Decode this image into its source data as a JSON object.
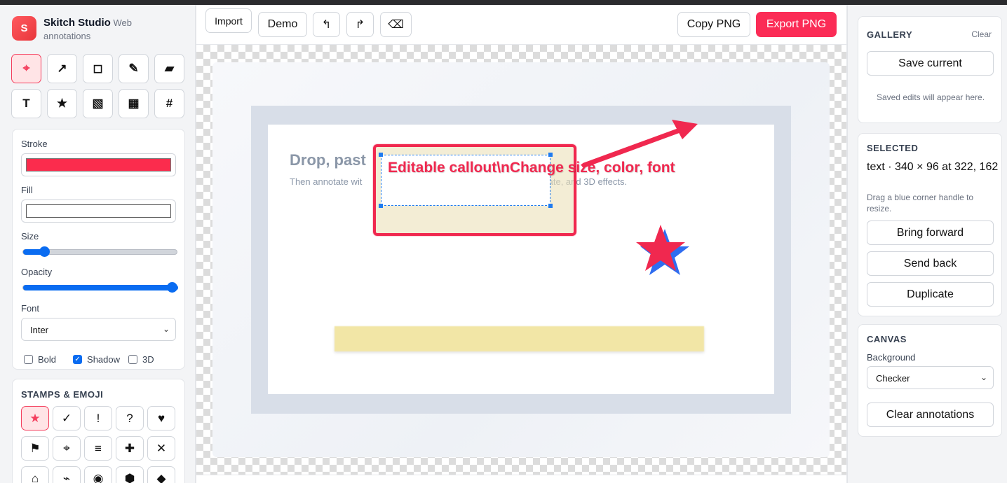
{
  "app": {
    "name": "Skitch Studio",
    "name_suffix": "Web",
    "subtitle": "annotations",
    "logo_letter": "S"
  },
  "tools": [
    {
      "icon": "crosshair-icon",
      "glyph": "⌖",
      "active": true
    },
    {
      "icon": "arrow-icon",
      "glyph": "↗"
    },
    {
      "icon": "rectangle-icon",
      "glyph": "◻"
    },
    {
      "icon": "pencil-icon",
      "glyph": "✎"
    },
    {
      "icon": "eraser-icon",
      "glyph": "▰"
    },
    {
      "icon": "text-icon",
      "glyph": "T"
    },
    {
      "icon": "star-icon",
      "glyph": "★"
    },
    {
      "icon": "blur-icon",
      "glyph": "▧"
    },
    {
      "icon": "pixelate-icon",
      "glyph": "▦"
    },
    {
      "icon": "number-icon",
      "glyph": "#"
    }
  ],
  "properties": {
    "stroke_label": "Stroke",
    "stroke_color": "#fb2c4d",
    "fill_label": "Fill",
    "fill_color": "#ffffff",
    "size_label": "Size",
    "size_fraction": 0.13,
    "opacity_label": "Opacity",
    "opacity_fraction": 1.0,
    "font_label": "Font",
    "font_value": "Inter",
    "bold_label": "Bold",
    "bold_checked": false,
    "shadow_label": "Shadow",
    "shadow_checked": true,
    "three_d_label": "3D",
    "three_d_checked": false
  },
  "stamps": {
    "title": "STAMPS & EMOJI",
    "items": [
      {
        "icon": "star-stamp-icon",
        "glyph": "★",
        "active": true
      },
      {
        "icon": "check-stamp-icon",
        "glyph": "✓"
      },
      {
        "icon": "exclamation-stamp-icon",
        "glyph": "!"
      },
      {
        "icon": "question-stamp-icon",
        "glyph": "?"
      },
      {
        "icon": "heart-stamp-icon",
        "glyph": "♥"
      },
      {
        "icon": "flag-stamp-icon",
        "glyph": "⚑"
      },
      {
        "icon": "crosshair-stamp-icon",
        "glyph": "⌖"
      },
      {
        "icon": "lines-stamp-icon",
        "glyph": "≡"
      },
      {
        "icon": "plus-stamp-icon",
        "glyph": "✚"
      },
      {
        "icon": "cross-stamp-icon",
        "glyph": "✕"
      },
      {
        "icon": "house-stamp-icon",
        "glyph": "⌂"
      },
      {
        "icon": "squiggle-stamp-icon",
        "glyph": "⌁"
      },
      {
        "icon": "target-stamp-icon",
        "glyph": "◉"
      },
      {
        "icon": "hexagon-stamp-icon",
        "glyph": "⬢"
      },
      {
        "icon": "diamond-stamp-icon",
        "glyph": "◆"
      }
    ]
  },
  "toolbar": {
    "import_label": "Import",
    "demo_label": "Demo",
    "undo_glyph": "↰",
    "redo_glyph": "↱",
    "delete_glyph": "⌫",
    "copy_label": "Copy PNG",
    "export_label": "Export PNG"
  },
  "canvas_content": {
    "drop_title": "Drop, past",
    "drop_subtitle_left": "Then annotate wit",
    "drop_subtitle_right": "xelate, and 3D effects.",
    "callout_text": "Editable callout\\nChange size, color, font"
  },
  "gallery": {
    "title": "GALLERY",
    "clear_label": "Clear",
    "save_label": "Save current",
    "empty_text": "Saved edits will appear here."
  },
  "selected": {
    "title": "SELECTED",
    "info": "text · 340 × 96 at 322, 162",
    "hint": "Drag a blue corner handle to resize.",
    "bring_forward_label": "Bring forward",
    "send_back_label": "Send back",
    "duplicate_label": "Duplicate"
  },
  "canvas_settings": {
    "title": "CANVAS",
    "background_label": "Background",
    "background_value": "Checker",
    "clear_annotations_label": "Clear annotations"
  }
}
